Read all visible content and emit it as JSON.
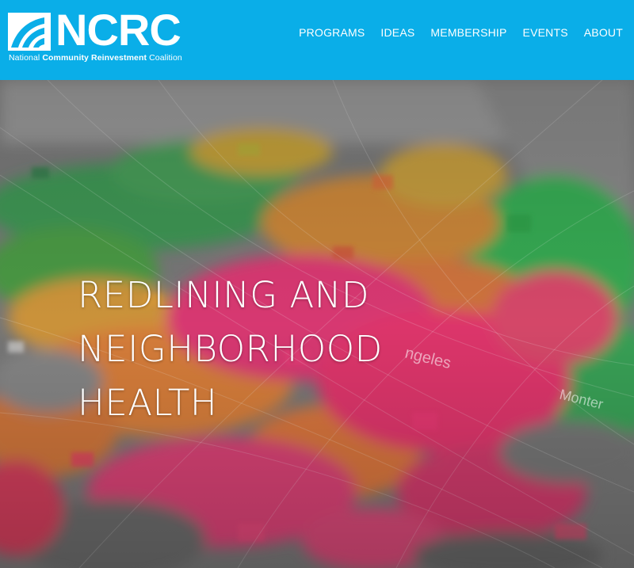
{
  "header": {
    "background_color": "#0aaee8",
    "logo": {
      "name": "NCRC",
      "tagline_parts": [
        "National ",
        "Community Reinvestment",
        " Coalition"
      ]
    },
    "nav": [
      {
        "label": "PROGRAMS"
      },
      {
        "label": "IDEAS"
      },
      {
        "label": "MEMBERSHIP"
      },
      {
        "label": "EVENTS"
      },
      {
        "label": "ABOUT"
      }
    ]
  },
  "hero": {
    "title_lines": [
      "REDLINING AND",
      "NEIGHBORHOOD",
      "HEALTH"
    ],
    "map_labels": [
      "ngeles",
      "Monter"
    ],
    "image_description_icon": "map-photo"
  }
}
